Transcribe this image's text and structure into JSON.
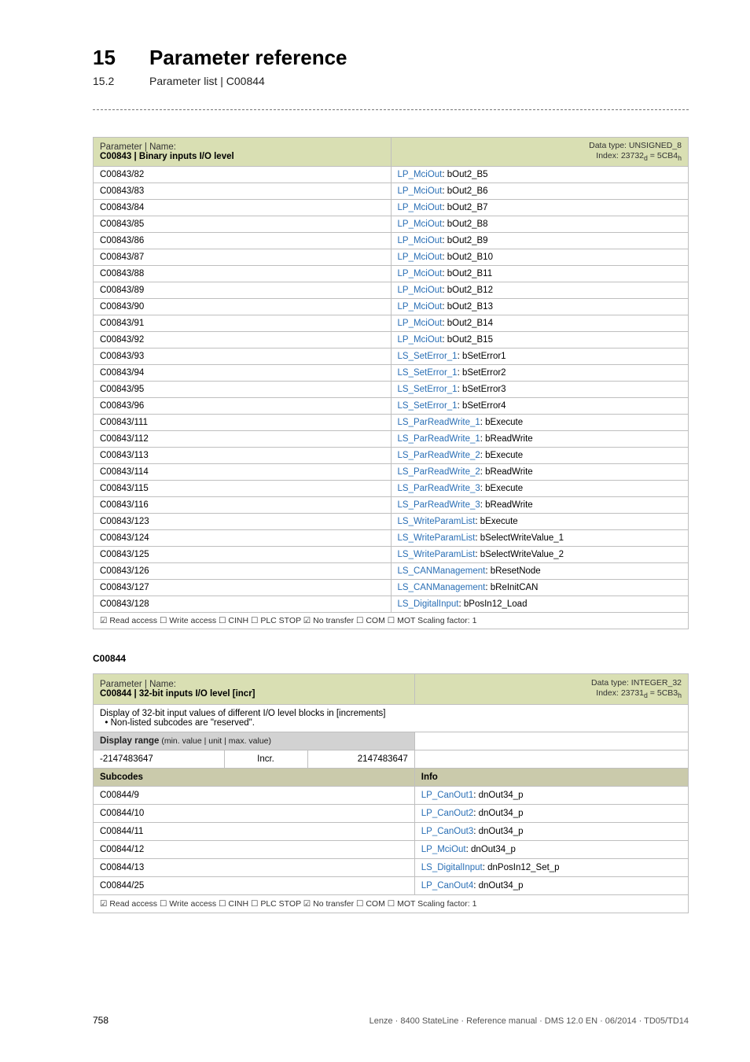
{
  "header": {
    "chapter_num": "15",
    "chapter_title": "Parameter reference",
    "section_num": "15.2",
    "section_title": "Parameter list | C00844"
  },
  "table1": {
    "param_label": "Parameter | Name:",
    "param_title": "C00843 | Binary inputs I/O level",
    "dtype": "Data type: UNSIGNED_8",
    "index": "Index: 23732",
    "index_sub_d": "d",
    "index_eq": " = 5CB4",
    "index_sub_h": "h",
    "rows": [
      {
        "c": "C00843/82",
        "l": "LP_MciOut",
        "s": ": bOut2_B5"
      },
      {
        "c": "C00843/83",
        "l": "LP_MciOut",
        "s": ": bOut2_B6"
      },
      {
        "c": "C00843/84",
        "l": "LP_MciOut",
        "s": ": bOut2_B7"
      },
      {
        "c": "C00843/85",
        "l": "LP_MciOut",
        "s": ": bOut2_B8"
      },
      {
        "c": "C00843/86",
        "l": "LP_MciOut",
        "s": ": bOut2_B9"
      },
      {
        "c": "C00843/87",
        "l": "LP_MciOut",
        "s": ": bOut2_B10"
      },
      {
        "c": "C00843/88",
        "l": "LP_MciOut",
        "s": ": bOut2_B11"
      },
      {
        "c": "C00843/89",
        "l": "LP_MciOut",
        "s": ": bOut2_B12"
      },
      {
        "c": "C00843/90",
        "l": "LP_MciOut",
        "s": ": bOut2_B13"
      },
      {
        "c": "C00843/91",
        "l": "LP_MciOut",
        "s": ": bOut2_B14"
      },
      {
        "c": "C00843/92",
        "l": "LP_MciOut",
        "s": ": bOut2_B15"
      },
      {
        "c": "C00843/93",
        "l": "LS_SetError_1",
        "s": ": bSetError1"
      },
      {
        "c": "C00843/94",
        "l": "LS_SetError_1",
        "s": ": bSetError2"
      },
      {
        "c": "C00843/95",
        "l": "LS_SetError_1",
        "s": ": bSetError3"
      },
      {
        "c": "C00843/96",
        "l": "LS_SetError_1",
        "s": ": bSetError4"
      },
      {
        "c": "C00843/111",
        "l": "LS_ParReadWrite_1",
        "s": ": bExecute"
      },
      {
        "c": "C00843/112",
        "l": "LS_ParReadWrite_1",
        "s": ": bReadWrite"
      },
      {
        "c": "C00843/113",
        "l": "LS_ParReadWrite_2",
        "s": ": bExecute"
      },
      {
        "c": "C00843/114",
        "l": "LS_ParReadWrite_2",
        "s": ": bReadWrite"
      },
      {
        "c": "C00843/115",
        "l": "LS_ParReadWrite_3",
        "s": ": bExecute"
      },
      {
        "c": "C00843/116",
        "l": "LS_ParReadWrite_3",
        "s": ": bReadWrite"
      },
      {
        "c": "C00843/123",
        "l": "LS_WriteParamList",
        "s": ": bExecute"
      },
      {
        "c": "C00843/124",
        "l": "LS_WriteParamList",
        "s": ": bSelectWriteValue_1"
      },
      {
        "c": "C00843/125",
        "l": "LS_WriteParamList",
        "s": ": bSelectWriteValue_2"
      },
      {
        "c": "C00843/126",
        "l": "LS_CANManagement",
        "s": ": bResetNode"
      },
      {
        "c": "C00843/127",
        "l": "LS_CANManagement",
        "s": ": bReInitCAN"
      },
      {
        "c": "C00843/128",
        "l": "LS_DigitalInput",
        "s": ": bPosIn12_Load"
      }
    ],
    "footer": "☑ Read access  ☐ Write access  ☐ CINH  ☐ PLC STOP  ☑ No transfer  ☐ COM  ☐ MOT   Scaling factor: 1"
  },
  "label2": "C00844",
  "table2": {
    "param_label": "Parameter | Name:",
    "param_title": "C00844 | 32-bit inputs I/O level [incr]",
    "dtype": "Data type: INTEGER_32",
    "index": "Index: 23731",
    "index_sub_d": "d",
    "index_eq": " = 5CB3",
    "index_sub_h": "h",
    "note_line1": "Display of 32-bit input values of different I/O level blocks in [increments]",
    "note_line2": "• Non-listed subcodes are \"reserved\".",
    "disp_range_label": "Display range",
    "disp_range_detail": " (min. value | unit | max. value)",
    "min": "-2147483647",
    "incr": "Incr.",
    "max": "2147483647",
    "sub_hdr_left": "Subcodes",
    "sub_hdr_right": "Info",
    "rows": [
      {
        "c": "C00844/9",
        "l": "LP_CanOut1",
        "s": ": dnOut34_p"
      },
      {
        "c": "C00844/10",
        "l": "LP_CanOut2",
        "s": ": dnOut34_p"
      },
      {
        "c": "C00844/11",
        "l": "LP_CanOut3",
        "s": ": dnOut34_p"
      },
      {
        "c": "C00844/12",
        "l": "LP_MciOut",
        "s": ": dnOut34_p"
      },
      {
        "c": "C00844/13",
        "l": "LS_DigitalInput",
        "s": ": dnPosIn12_Set_p"
      },
      {
        "c": "C00844/25",
        "l": "LP_CanOut4",
        "s": ": dnOut34_p"
      }
    ],
    "footer": "☑ Read access  ☐ Write access  ☐ CINH  ☐ PLC STOP  ☑ No transfer  ☐ COM  ☐ MOT   Scaling factor: 1"
  },
  "footer": {
    "page": "758",
    "meta": "Lenze · 8400 StateLine · Reference manual · DMS 12.0 EN · 06/2014 · TD05/TD14"
  }
}
